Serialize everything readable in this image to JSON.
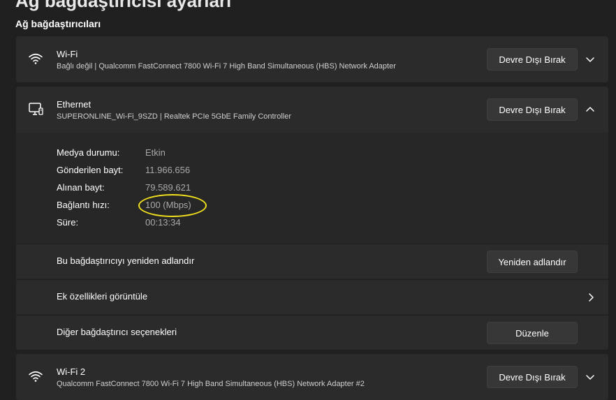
{
  "page": {
    "partial_heading": "Ağ bağdaştırıcısı ayarları",
    "section_title": "Ağ bağdaştırıcıları"
  },
  "adapters": [
    {
      "name": "Wi-Fi",
      "description": "Bağlı değil | Qualcomm FastConnect 7800 Wi-Fi 7 High Band Simultaneous (HBS) Network Adapter",
      "button_label": "Devre Dışı Bırak",
      "icon": "wifi-icon",
      "expanded": false
    },
    {
      "name": "Ethernet",
      "description": "SUPERONLINE_Wi-Fi_9SZD | Realtek PCIe 5GbE Family Controller",
      "button_label": "Devre Dışı Bırak",
      "icon": "ethernet-icon",
      "expanded": true,
      "properties": [
        {
          "label": "Medya durumu:",
          "value": "Etkin"
        },
        {
          "label": "Gönderilen bayt:",
          "value": "11.966.656"
        },
        {
          "label": "Alınan bayt:",
          "value": "79.589.621"
        },
        {
          "label": "Bağlantı hızı:",
          "value": "100 (Mbps)"
        },
        {
          "label": "Süre:",
          "value": "00:13:34"
        }
      ],
      "rename": {
        "label": "Bu bağdaştırıcıyı yeniden adlandır",
        "button_label": "Yeniden adlandır"
      },
      "more_properties": {
        "label": "Ek özellikleri görüntüle"
      },
      "other_options": {
        "label": "Diğer bağdaştırıcı seçenekleri",
        "button_label": "Düzenle"
      }
    },
    {
      "name": "Wi-Fi 2",
      "description": "Qualcomm FastConnect 7800 Wi-Fi 7 High Band Simultaneous (HBS) Network Adapter #2",
      "button_label": "Devre Dışı Bırak",
      "icon": "wifi-icon",
      "expanded": false
    }
  ],
  "colors": {
    "background": "#202020",
    "card": "#2b2b2b",
    "highlight_annotation": "#f2e01e"
  }
}
